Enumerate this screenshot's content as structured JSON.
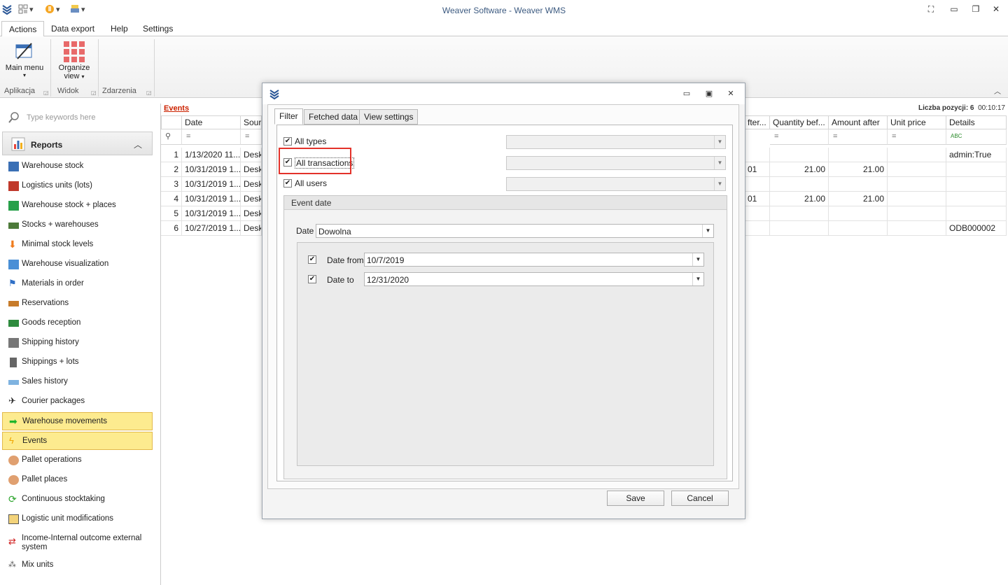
{
  "window": {
    "title": "Weaver Software - Weaver WMS"
  },
  "ribbon": {
    "tabs": [
      "Actions",
      "Data export",
      "Help",
      "Settings"
    ],
    "main_menu": "Main menu",
    "organize_view_1": "Organize",
    "organize_view_2": "view",
    "groups": [
      "Aplikacja",
      "Widok",
      "Zdarzenia"
    ]
  },
  "nav": {
    "search_placeholder": "Type keywords here",
    "section": "Reports",
    "items": [
      "Warehouse stock",
      "Logistics units (lots)",
      "Warehouse stock + places",
      "Stocks + warehouses",
      "Minimal stock levels",
      "Warehouse visualization",
      "Materials in order",
      "Reservations",
      "Goods reception",
      "Shipping history",
      "Shippings + lots",
      "Sales history",
      "Courier packages",
      "Warehouse movements",
      "Events",
      "Pallet operations",
      "Pallet places",
      "Continuous stocktaking",
      "Logistic unit modifications",
      "Income-Internal outcome external system",
      "Mix units"
    ]
  },
  "grid": {
    "link": "Events",
    "count_label": "Liczba pozycji: 6",
    "timer": "00:10:17",
    "headers": [
      "Date",
      "Sourc",
      "fter...",
      "Quantity bef...",
      "Amount after",
      "Unit price",
      "Details"
    ],
    "filter_symbol": "=",
    "details_filter": "ABC",
    "rows": [
      {
        "n": "1",
        "date": "1/13/2020 11...",
        "src": "Deskt",
        "after": "",
        "qty": "",
        "amt": "",
        "price": "",
        "details": "admin:True"
      },
      {
        "n": "2",
        "date": "10/31/2019 1...",
        "src": "Deskt",
        "after": "01",
        "qty": "21.00",
        "amt": "21.00",
        "price": "",
        "details": ""
      },
      {
        "n": "3",
        "date": "10/31/2019 1...",
        "src": "Deskt",
        "after": "",
        "qty": "",
        "amt": "",
        "price": "",
        "details": ""
      },
      {
        "n": "4",
        "date": "10/31/2019 1...",
        "src": "Deskt",
        "after": "01",
        "qty": "21.00",
        "amt": "21.00",
        "price": "",
        "details": ""
      },
      {
        "n": "5",
        "date": "10/31/2019 1...",
        "src": "Deskt",
        "after": "",
        "qty": "",
        "amt": "",
        "price": "",
        "details": ""
      },
      {
        "n": "6",
        "date": "10/27/2019 1...",
        "src": "Deskt",
        "after": "",
        "qty": "",
        "amt": "",
        "price": "",
        "details": "ODB000002"
      }
    ]
  },
  "dialog": {
    "tabs": [
      "Filter",
      "Fetched data",
      "View settings"
    ],
    "all_types": "All types",
    "all_transactions": "All transactions",
    "all_users": "All users",
    "event_date_group": "Event date",
    "date_label": "Date",
    "date_value": "Dowolna",
    "date_from_label": "Date from",
    "date_from_value": "10/7/2019",
    "date_to_label": "Date to",
    "date_to_value": "12/31/2020",
    "save": "Save",
    "cancel": "Cancel"
  },
  "colors": {
    "accent": "#2b5797",
    "highlight": "#e3322a",
    "selected_nav": "#fdeb8f",
    "events_link": "#cc2200"
  }
}
